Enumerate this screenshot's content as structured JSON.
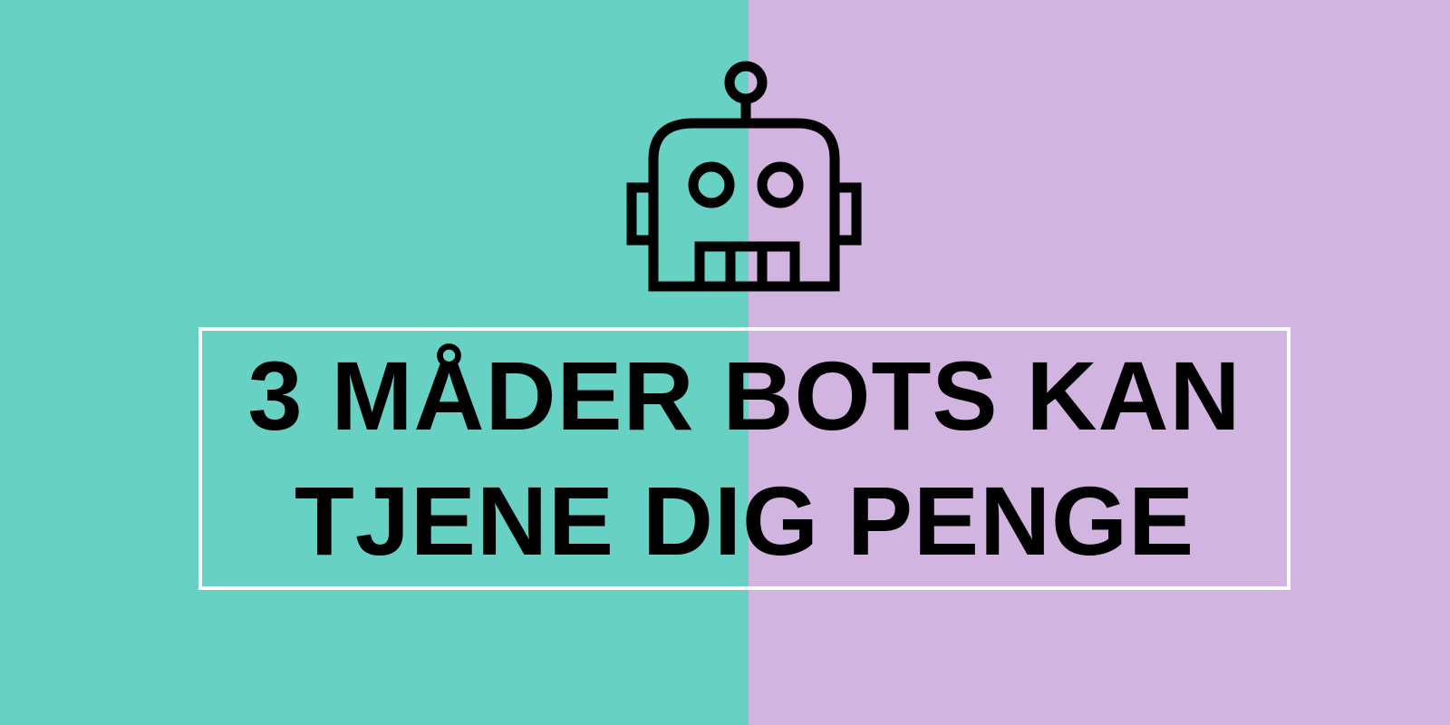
{
  "colors": {
    "left_background": "#67d1c4",
    "right_background": "#d1b4e0",
    "frame": "#ffffff",
    "text": "#000000",
    "icon_stroke": "#000000"
  },
  "icon": "robot-head-icon",
  "title": {
    "line1": "3 MÅDER BOTS KAN",
    "line2": "TJENE DIG PENGE"
  }
}
